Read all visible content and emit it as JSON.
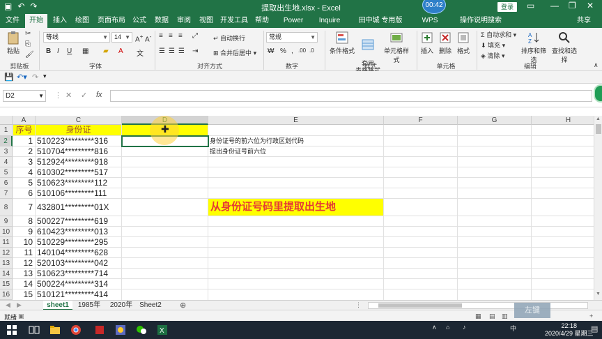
{
  "window": {
    "title": "提取出生地.xlsx - Excel",
    "login_label": "登录",
    "recording_time": "00:42"
  },
  "ribbon_tabs": [
    "文件",
    "开始",
    "插入",
    "绘图",
    "页面布局",
    "公式",
    "数据",
    "审阅",
    "视图",
    "开发工具",
    "帮助",
    "Power Pivot",
    "Inquire",
    "田中城 专用版",
    "WPS PDF",
    "操作说明搜索",
    "共享"
  ],
  "active_tab": "开始",
  "ribbon": {
    "paste_label": "粘贴",
    "clipboard_group": "剪贴板",
    "font_name": "等线",
    "font_size": "14",
    "font_group": "字体",
    "align_group": "对齐方式",
    "wrap_text": "自动换行",
    "merge_center": "合并后居中",
    "number_format": "常规",
    "number_group": "数字",
    "cond_format": "条件格式",
    "table_format": "套用\n表格格式",
    "cell_style": "单元格样式",
    "styles_group": "样式",
    "insert": "插入",
    "delete": "删除",
    "format": "格式",
    "cells_group": "单元格",
    "autosum": "自动求和",
    "fill": "填充",
    "clear": "清除",
    "sort_filter": "排序和筛选",
    "find_select": "查找和选择",
    "edit_group": "编辑"
  },
  "formula_bar": {
    "name_box": "D2",
    "cancel": "✕",
    "enter": "✓",
    "fx": "fx",
    "content": ""
  },
  "columns": [
    "A",
    "C",
    "D",
    "E",
    "F",
    "G",
    "H"
  ],
  "rows": [
    "1",
    "2",
    "3",
    "4",
    "5",
    "6",
    "7",
    "8",
    "9",
    "10",
    "11",
    "12",
    "13",
    "14",
    "15",
    "16"
  ],
  "header_row": {
    "seq": "序号",
    "id": "身份证"
  },
  "data_rows": [
    {
      "seq": "1",
      "id": "510223*********316"
    },
    {
      "seq": "2",
      "id": "510704*********816"
    },
    {
      "seq": "3",
      "id": "512924*********918"
    },
    {
      "seq": "4",
      "id": "610302*********517"
    },
    {
      "seq": "5",
      "id": "510623*********112"
    },
    {
      "seq": "6",
      "id": "510106*********111"
    },
    {
      "seq": "7",
      "id": "432801*********01X"
    },
    {
      "seq": "8",
      "id": "500227*********619"
    },
    {
      "seq": "9",
      "id": "610423*********013"
    },
    {
      "seq": "10",
      "id": "510229*********295"
    },
    {
      "seq": "11",
      "id": "140104*********628"
    },
    {
      "seq": "12",
      "id": "520103*********042"
    },
    {
      "seq": "13",
      "id": "510623*********714"
    },
    {
      "seq": "14",
      "id": "500224*********314"
    },
    {
      "seq": "15",
      "id": "510121*********414"
    }
  ],
  "notes": {
    "e2": "身份证号的前六位为行政区划代码",
    "e3": "提出身份证号前六位",
    "banner": "从身份证号码里提取出生地"
  },
  "sheets": [
    "sheet1",
    "1985年",
    "2020年",
    "Sheet2"
  ],
  "active_sheet": "sheet1",
  "status": {
    "ready": "就绪",
    "zoom": "+"
  },
  "taskbar": {
    "time": "22:18",
    "date": "2020/4/29 星期三",
    "ime": "中",
    "watermark": "左键"
  }
}
